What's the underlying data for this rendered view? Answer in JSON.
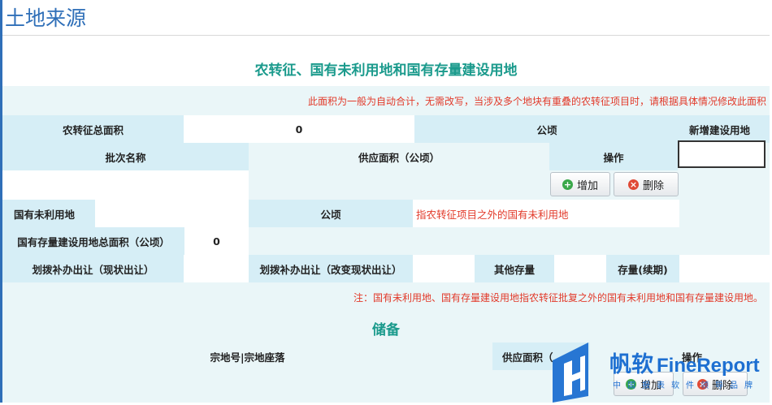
{
  "page": {
    "title": "土地来源"
  },
  "section1": {
    "title": "农转征、国有未利用地和国有存量建设用地",
    "note": "此面积为一般为自动合计，无需改写，当涉及多个地块有重叠的农转征项目时，请根据具体情况修改此面积"
  },
  "row_total": {
    "label": "农转征总面积",
    "value": "0",
    "unit": "公顷",
    "new_land_label": "新增建设用地"
  },
  "batch_table": {
    "headers": [
      "批次名称",
      "供应面积（公顷）",
      "操作"
    ]
  },
  "buttons": {
    "add": "增加",
    "delete": "删除"
  },
  "unused_land": {
    "label": "国有未利用地",
    "unit": "公顷",
    "hint": "指农转征项目之外的国有未利用地"
  },
  "stock_land": {
    "label": "国有存量建设用地总面积（公顷）",
    "value": "0"
  },
  "stock_headers": [
    "划拨补办出让（现状出让）",
    "划拨补办出让（改变现状出让）",
    "其他存量",
    "存量(续期)"
  ],
  "footnote": "注：国有未利用地、国有存量建设用地指农转征批复之外的国有未利用地和国有存量建设用地。",
  "reserve": {
    "title": "储备",
    "headers": [
      "宗地号|宗地座落",
      "供应面积（",
      "操作"
    ]
  },
  "logo": {
    "text": "帆软FineReport",
    "tagline": "中国报表软件领导品牌"
  },
  "colors": {
    "accent_blue": "#2f6fb8",
    "teal_title": "#1a9a8c",
    "warning_red": "#e23a2a",
    "header_bg": "#d6eef6",
    "band_bg": "#eaf6f8"
  }
}
